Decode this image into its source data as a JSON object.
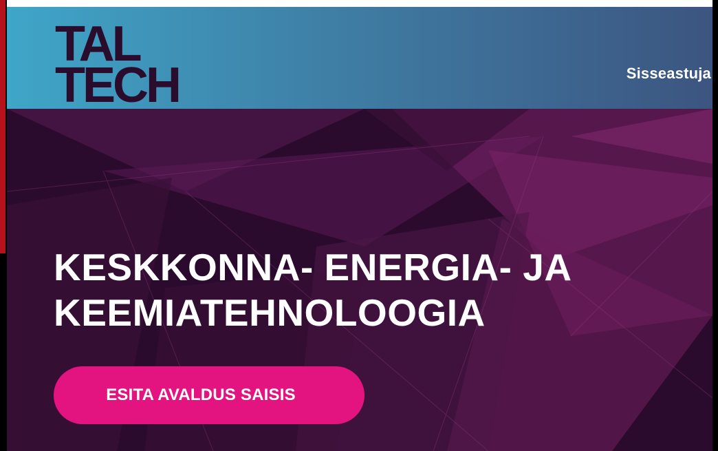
{
  "logo": {
    "line1": "TAL",
    "line2": "TECH"
  },
  "nav": {
    "link_label": "Sisseastuja"
  },
  "hero": {
    "title_line1": "KESKKONNA- ENERGIA- JA",
    "title_line2": "KEEMIATEHNOLOOGIA",
    "cta_label": "ESITA AVALDUS SAISIS"
  },
  "colors": {
    "header_gradient_start": "#3fa6c8",
    "header_gradient_end": "#3c5580",
    "hero_background": "#2b0b2d",
    "cta_background": "#e3147f",
    "logo_color": "#2a0d2c"
  }
}
